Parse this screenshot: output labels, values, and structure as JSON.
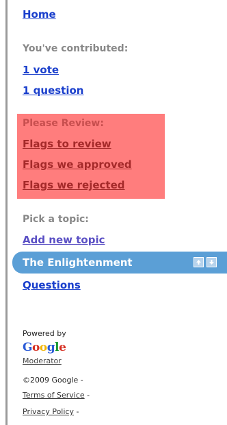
{
  "nav": {
    "home": "Home"
  },
  "contributed": {
    "label": "You've contributed:",
    "votes": "1 vote",
    "questions": "1 question"
  },
  "review": {
    "title": "Please Review:",
    "items": [
      "Flags to review",
      "Flags we approved",
      "Flags we rejected"
    ],
    "bg_color": "#ff7d7d"
  },
  "topics": {
    "label": "Pick a topic:",
    "add": "Add new topic",
    "selected": "The Enlightenment",
    "questions_link": "Questions",
    "bar_color": "#5b9fd6"
  },
  "footer": {
    "powered_by": "Powered by",
    "logo_letters": [
      "G",
      "o",
      "o",
      "g",
      "l",
      "e"
    ],
    "moderator": "Moderator",
    "copyright": "©2009 Google",
    "separator": "-",
    "terms": "Terms of Service",
    "privacy": "Privacy Policy"
  },
  "icons": {
    "move_up": "arrow-up-icon",
    "move_down": "arrow-down-icon"
  }
}
